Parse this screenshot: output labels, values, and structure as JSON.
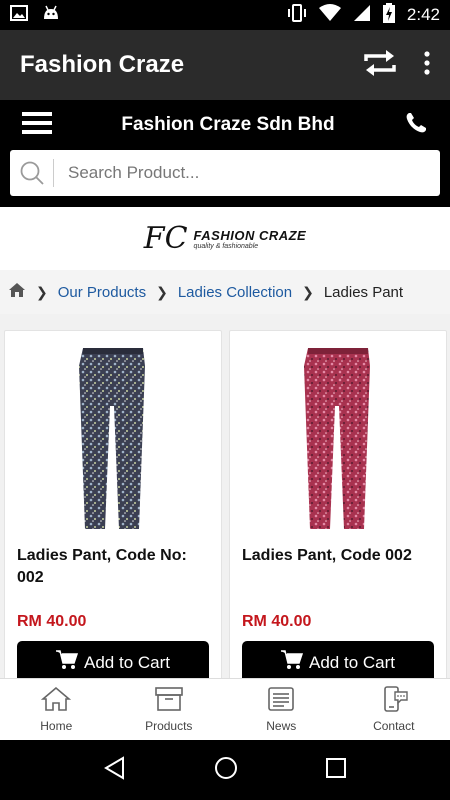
{
  "status_bar": {
    "time": "2:42"
  },
  "app_bar": {
    "title": "Fashion Craze"
  },
  "store": {
    "name": "Fashion Craze Sdn Bhd",
    "search_placeholder": "Search Product..."
  },
  "logo": {
    "mark": "FC",
    "name": "FASHION CRAZE",
    "tagline": "quality & fashionable"
  },
  "breadcrumb": {
    "items": [
      "Our Products",
      "Ladies Collection"
    ],
    "current": "Ladies Pant"
  },
  "products": [
    {
      "title": "Ladies Pant, Code No: 002",
      "price": "RM 40.00",
      "button": "Add to Cart",
      "pattern_color": "#3b3f52"
    },
    {
      "title": "Ladies Pant, Code 002",
      "price": "RM 40.00",
      "button": "Add to Cart",
      "pattern_color": "#a8324f"
    }
  ],
  "bottom_nav": {
    "items": [
      {
        "label": "Home",
        "icon": "home-icon"
      },
      {
        "label": "Products",
        "icon": "archive-box-icon"
      },
      {
        "label": "News",
        "icon": "newspaper-icon"
      },
      {
        "label": "Contact",
        "icon": "phone-chat-icon"
      }
    ]
  },
  "colors": {
    "price": "#c4171d",
    "link": "#1e5aa0",
    "app_bar": "#2b2b2b"
  }
}
